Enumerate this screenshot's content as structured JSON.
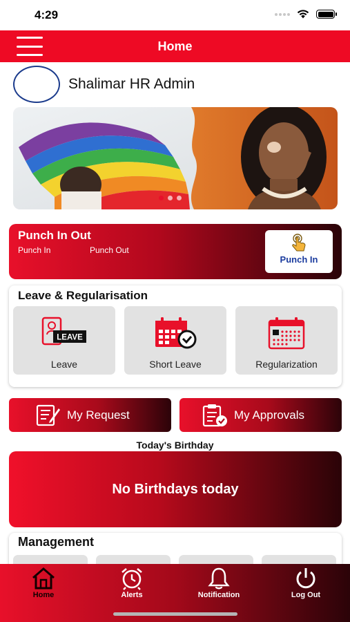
{
  "status_bar": {
    "time": "4:29"
  },
  "header": {
    "title": "Home"
  },
  "profile": {
    "name": "Shalimar HR Admin"
  },
  "banner": {
    "slide_count": 3,
    "active_slide": 1
  },
  "punch": {
    "title": "Punch In Out",
    "punch_in_label": "Punch In",
    "punch_out_label": "Punch Out",
    "button_label": "Punch In"
  },
  "leave_section": {
    "title": "Leave & Regularisation",
    "items": [
      {
        "label": "Leave",
        "icon": "leave-icon",
        "badge": "LEAVE"
      },
      {
        "label": "Short Leave",
        "icon": "calendar-check-icon"
      },
      {
        "label": "Regularization",
        "icon": "calendar-icon"
      }
    ]
  },
  "requests": {
    "my_request": "My Request",
    "my_approvals": "My Approvals"
  },
  "birthday": {
    "heading": "Today's Birthday",
    "message": "No Birthdays today"
  },
  "management": {
    "title": "Management"
  },
  "bottom_nav": [
    {
      "label": "Home",
      "icon": "home-icon",
      "active": true
    },
    {
      "label": "Alerts",
      "icon": "alarm-clock-icon",
      "active": false
    },
    {
      "label": "Notification",
      "icon": "bell-icon",
      "active": false
    },
    {
      "label": "Log Out",
      "icon": "power-icon",
      "active": false
    }
  ],
  "colors": {
    "brand_red": "#ee0a24",
    "dark_red": "#2a0308",
    "punch_blue": "#1a3b9e",
    "tile_grey": "#e2e2e2"
  }
}
